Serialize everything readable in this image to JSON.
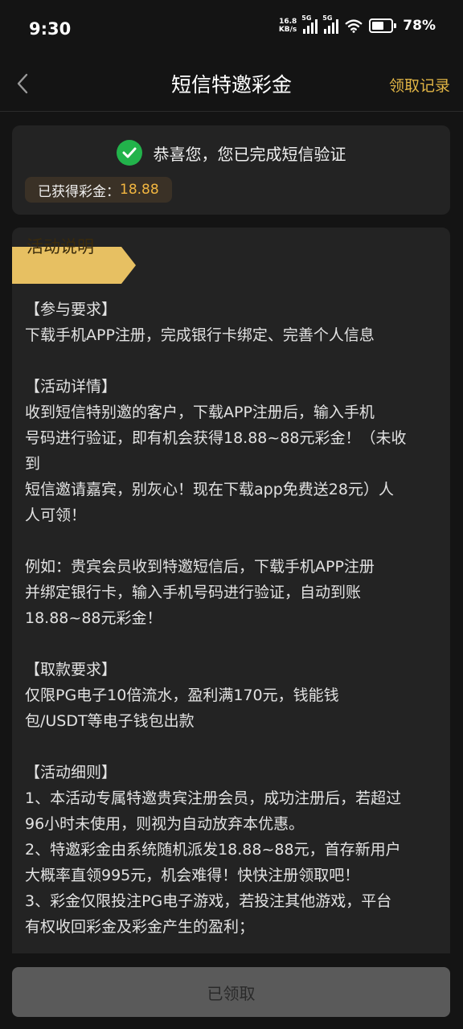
{
  "status_bar": {
    "time": "9:30",
    "net_speed_value": "16.8",
    "net_speed_unit": "KB/s",
    "signal1_tag": "5G",
    "signal2_tag": "5G",
    "battery_percent": "78%",
    "battery_level": 0.78
  },
  "header": {
    "title": "短信特邀彩金",
    "records_link": "领取记录"
  },
  "verify": {
    "message": "恭喜您，您已完成短信验证",
    "bonus_label": "已获得彩金：",
    "bonus_value": "18.88"
  },
  "rules": {
    "ribbon": "活动说明",
    "lines": [
      "【参与要求】",
      "下载手机APP注册，完成银行卡绑定、完善个人信息",
      "",
      "【活动详情】",
      "收到短信特别邀的客户，下载APP注册后，输入手机",
      "号码进行验证，即有机会获得18.88~88元彩金！（未收",
      "到",
      "短信邀请嘉宾，别灰心！现在下载app免费送28元）人",
      "人可领！",
      "",
      "例如：贵宾会员收到特邀短信后，下载手机APP注册",
      "并绑定银行卡，输入手机号码进行验证，自动到账",
      "18.88~88元彩金！",
      "",
      "【取款要求】",
      "仅限PG电子10倍流水，盈利满170元，钱能钱",
      "包/USDT等电子钱包出款",
      "",
      "【活动细则】",
      "1、本活动专属特邀贵宾注册会员，成功注册后，若超过",
      "96小时未使用，则视为自动放弃本优惠。",
      "2、特邀彩金由系统随机派发18.88~88元，首存新用户",
      "大概率直领995元，机会难得！快快注册领取吧！",
      "3、彩金仅限投注PG电子游戏，若投注其他游戏，平台",
      "有权收回彩金及彩金产生的盈利；"
    ]
  },
  "bottom": {
    "button_label": "已领取"
  },
  "colors": {
    "background": "#141414",
    "card": "#232323",
    "accent_gold": "#e0b445",
    "success_green": "#22b34b",
    "ribbon_gold": "#e7c062"
  }
}
